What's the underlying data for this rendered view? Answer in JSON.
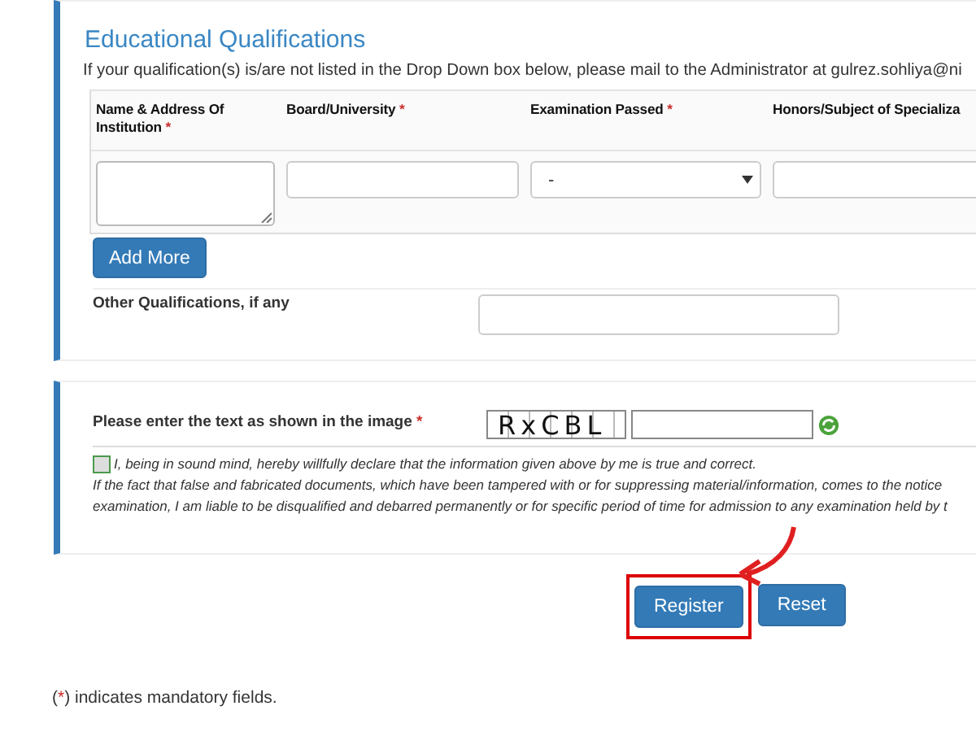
{
  "qualifications": {
    "title": "Educational Qualifications",
    "note": "If your qualification(s) is/are not listed in the Drop Down box below, please mail to the Administrator at gulrez.sohliya@ni",
    "columns": [
      {
        "label": "Name & Address Of Institution",
        "required_mark": "*",
        "kind": "textarea"
      },
      {
        "label": "Board/University",
        "required_mark": "*",
        "kind": "input"
      },
      {
        "label": "Examination Passed",
        "required_mark": "*",
        "kind": "select",
        "value": "-"
      },
      {
        "label": "Honors/Subject of Specializa",
        "kind": "input"
      }
    ],
    "add_button": "Add More",
    "other_label": "Other Qualifications, if any"
  },
  "verification": {
    "captcha_label": "Please enter the text as shown in the image",
    "captcha_required_mark": "*",
    "captcha_text": "RxCBL",
    "declaration_checked": false,
    "declaration_lines": [
      "I, being in sound mind, hereby willfully declare that the information given above by me is true and correct.",
      "If the fact that false and fabricated documents, which have been tampered with or for suppressing material/information, comes to the notice",
      "examination, I am liable to be disqualified and debarred permanently or for specific period of time for admission to any examination held by t"
    ]
  },
  "buttons": [
    {
      "label": "Register",
      "highlighted": true
    },
    {
      "label": "Reset",
      "highlighted": false
    }
  ],
  "footer": {
    "open": "(",
    "mark": "*",
    "text": ") indicates mandatory fields."
  }
}
